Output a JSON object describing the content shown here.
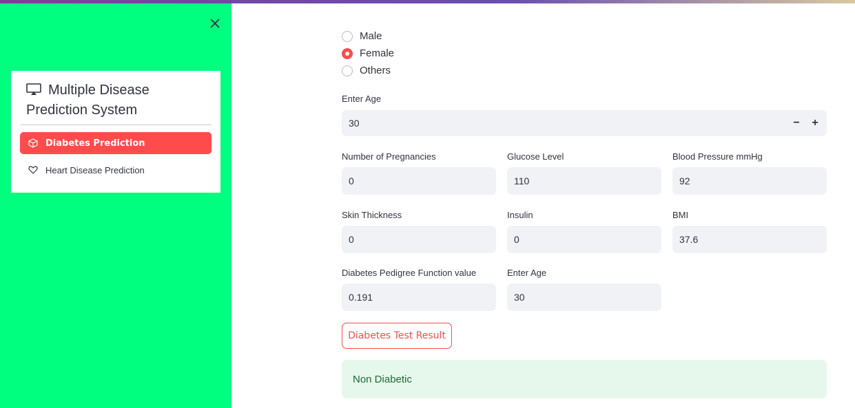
{
  "sidebar": {
    "menu_title": "Multiple Disease Prediction System",
    "items": [
      {
        "label": "Diabetes Prediction",
        "icon": "box-icon",
        "active": true
      },
      {
        "label": "Heart Disease Prediction",
        "icon": "heart-icon",
        "active": false
      }
    ],
    "accent_color": "#ff4b4b",
    "background_color": "#00ff7f"
  },
  "gender": {
    "options": [
      "Male",
      "Female",
      "Others"
    ],
    "selected": "Female"
  },
  "age_stepper": {
    "label": "Enter Age",
    "value": "30",
    "minus": "−",
    "plus": "+"
  },
  "fields": {
    "pregnancies": {
      "label": "Number of Pregnancies",
      "value": "0"
    },
    "glucose": {
      "label": "Glucose Level",
      "value": "110"
    },
    "blood_pressure": {
      "label": "Blood Pressure mmHg",
      "value": "92"
    },
    "skin_thickness": {
      "label": "Skin Thickness",
      "value": "0"
    },
    "insulin": {
      "label": "Insulin",
      "value": "0"
    },
    "bmi": {
      "label": "BMI",
      "value": "37.6"
    },
    "pedigree": {
      "label": "Diabetes Pedigree Function value",
      "value": "0.191"
    },
    "age": {
      "label": "Enter Age",
      "value": "30"
    }
  },
  "button": {
    "label": "Diabetes Test Result"
  },
  "result": {
    "text": "Non Diabetic",
    "color": "#1d6a36"
  }
}
